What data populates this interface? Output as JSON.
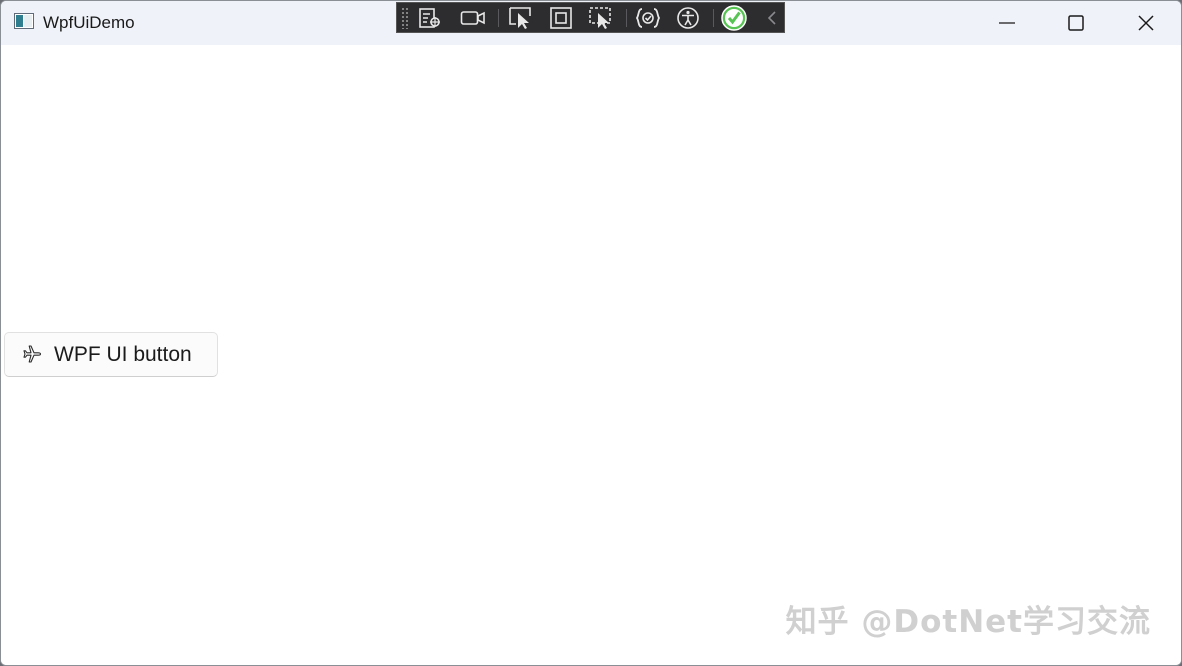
{
  "window": {
    "title": "WpfUiDemo",
    "app_icon": "app-window-icon"
  },
  "caption_buttons": {
    "minimize": "minimize-icon",
    "maximize": "maximize-icon",
    "close": "close-icon"
  },
  "dev_toolbar": {
    "items": [
      "visual-tree-icon",
      "video-camera-icon",
      "select-element-icon",
      "display-layout-adorners-icon",
      "track-focus-icon",
      "hot-reload-icon",
      "accessibility-icon",
      "status-ok-icon",
      "collapse-chevron-icon"
    ],
    "status_color": "#58c454"
  },
  "content": {
    "button_label": "WPF UI button",
    "button_icon": "fluent-airplane-icon"
  },
  "watermark": {
    "text": "知乎 @DotNet学习交流"
  }
}
